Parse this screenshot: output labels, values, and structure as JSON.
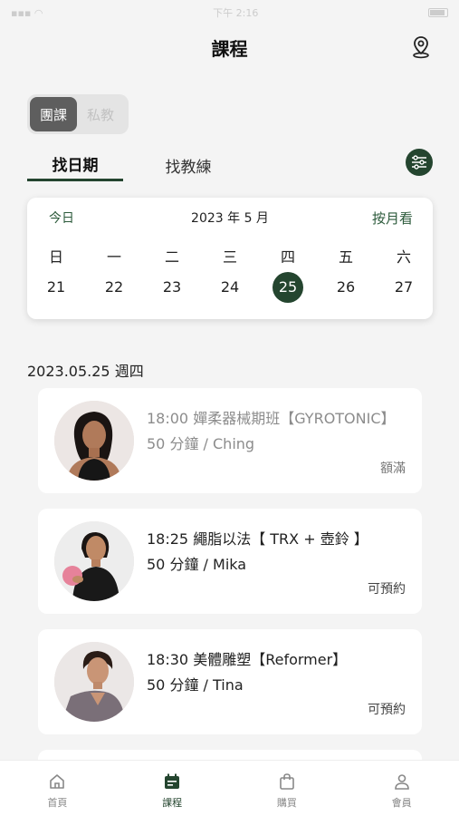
{
  "status_bar": {
    "time": "下午 2:16"
  },
  "header": {
    "title": "課程"
  },
  "segment": {
    "group": "團課",
    "private": "私教"
  },
  "tabs": {
    "by_date": "找日期",
    "by_coach": "找教練"
  },
  "calendar": {
    "today_label": "今日",
    "month_label": "2023 年 5 月",
    "by_month_label": "按月看",
    "weekdays": [
      "日",
      "一",
      "二",
      "三",
      "四",
      "五",
      "六"
    ],
    "days": [
      "21",
      "22",
      "23",
      "24",
      "25",
      "26",
      "27"
    ],
    "selected_day": "25"
  },
  "date_heading": "2023.05.25 週四",
  "classes": [
    {
      "title": "18:00 嬋柔器械期班【GYROTONIC】",
      "subtitle": "50 分鐘 / Ching",
      "status": "額滿",
      "full": true
    },
    {
      "title": "18:25 繩脂以法【 TRX + 壺鈴 】",
      "subtitle": "50 分鐘 / Mika",
      "status": "可預約",
      "full": false
    },
    {
      "title": "18:30 美體雕塑【Reformer】",
      "subtitle": "50 分鐘 / Tina",
      "status": "可預約",
      "full": false
    }
  ],
  "bottom_nav": [
    {
      "label": "首頁",
      "icon": "home-icon"
    },
    {
      "label": "課程",
      "icon": "calendar-icon"
    },
    {
      "label": "購買",
      "icon": "shopping-bag-icon"
    },
    {
      "label": "會員",
      "icon": "user-icon"
    }
  ],
  "colors": {
    "accent": "#24452f",
    "accent_text": "#2c5a3b",
    "background": "#f4f4f4"
  }
}
